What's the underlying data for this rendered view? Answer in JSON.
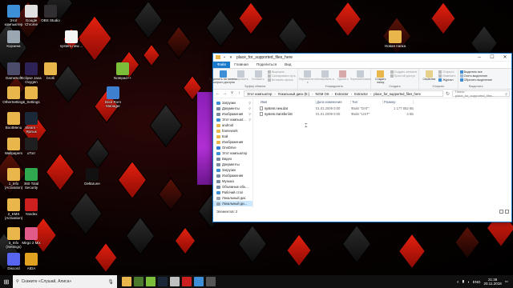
{
  "desktop_icons": [
    {
      "label": "Этот\nкомпьютер",
      "icon": "computer-icon",
      "color": "#3d8fd6"
    },
    {
      "label": "Google\nChrome",
      "icon": "chrome-icon",
      "color": "#e0e0e0"
    },
    {
      "label": "OBS Studio",
      "icon": "obs-icon",
      "color": "#302e31"
    },
    {
      "label": "Корзина",
      "icon": "recycle-bin-icon",
      "color": "#9aa6b2"
    },
    {
      "label": "system.new....",
      "icon": "file-icon",
      "color": "#f5f5f5"
    },
    {
      "label": "Новая папка",
      "icon": "folder-icon",
      "color": "#e8b64a"
    },
    {
      "label": "GameSoft",
      "icon": "gamesoft-icon",
      "color": "#4b4b6a"
    },
    {
      "label": "Eclipse Java\nOxygen",
      "icon": "eclipse-icon",
      "color": "#2c2255"
    },
    {
      "label": "brotli",
      "icon": "folder-icon",
      "color": "#e8b64a"
    },
    {
      "label": "Notepad++",
      "icon": "notepadpp-icon",
      "color": "#7cbd3a"
    },
    {
      "label": "OtherSettings",
      "icon": "folder-icon",
      "color": "#e8b64a"
    },
    {
      "label": "4_Settings",
      "icon": "folder-icon",
      "color": "#e8b64a"
    },
    {
      "label": "Boot Rom\nManager",
      "icon": "boot-rom-icon",
      "color": "#3f7fd0"
    },
    {
      "label": "BootMenu",
      "icon": "folder-icon",
      "color": "#e8b64a"
    },
    {
      "label": "Steam -\nЯрлык",
      "icon": "steam-icon",
      "color": "#1b2838"
    },
    {
      "label": "Wallpapers",
      "icon": "folder-icon",
      "color": "#e8b64a"
    },
    {
      "label": "uTorr",
      "icon": "utorrent-icon",
      "color": "#1f1f1f"
    },
    {
      "label": "Deltarune",
      "icon": "deltarune-icon",
      "color": "#111111"
    },
    {
      "label": "1_Info\n(Activation)",
      "icon": "folder-icon",
      "color": "#e8b64a"
    },
    {
      "label": "360 Total\nSecurity",
      "icon": "security-icon",
      "color": "#2fa84f"
    },
    {
      "label": "2_KMS\n(Activation)",
      "icon": "folder-icon",
      "color": "#e8b64a"
    },
    {
      "label": "Yandex",
      "icon": "yandex-icon",
      "color": "#cc1f1f"
    },
    {
      "label": "3_Info\n(Settings)",
      "icon": "folder-icon",
      "color": "#e8b64a"
    },
    {
      "label": "Mirgo 2 Mix",
      "icon": "mirgo-icon",
      "color": "#e05a8a"
    },
    {
      "label": "Discord",
      "icon": "discord-icon",
      "color": "#5865f2"
    },
    {
      "label": "AIDA",
      "icon": "aida-icon",
      "color": "#e0a020"
    }
  ],
  "explorer": {
    "title": "place_for_supported_files_here",
    "tabs": [
      "Файл",
      "Главная",
      "Поделиться",
      "Вид"
    ],
    "ribbon": {
      "clipboard": {
        "name": "Буфер обмена",
        "pin": "Закрепить на панели быстрого доступа",
        "copy": "Копировать",
        "paste": "Вставить",
        "cut": "Вырезать",
        "copy_path": "Скопировать путь",
        "paste_shortcut": "Вставить ярлык"
      },
      "organize": {
        "name": "Упорядочить",
        "move": "Переместить в",
        "copy_to": "Копировать в",
        "delete": "Удалить",
        "rename": "Переименовать"
      },
      "new": {
        "name": "Создать",
        "new_folder": "Создать папку",
        "new_item": "Создать элемент",
        "easy_access": "Простой доступ"
      },
      "open": {
        "name": "Открыть",
        "properties": "Свойства",
        "open": "Открыть",
        "edit": "Изменить",
        "history": "Журнал"
      },
      "select": {
        "name": "Выделить",
        "select_all": "Выделить все",
        "select_none": "Снять выделение",
        "invert": "Обратить выделение"
      }
    },
    "breadcrumb": [
      "Этот компьютер",
      "Локальный диск (E:)",
      "NGM OS",
      "Extractor",
      "Extractor",
      "place_for_supported_files_here"
    ],
    "search_placeholder": "Поиск: place_for_supported_files...",
    "nav": [
      {
        "label": "Загрузки",
        "color": "#3d8fd6",
        "pin": true
      },
      {
        "label": "Документы",
        "color": "#7a8da3",
        "pin": true
      },
      {
        "label": "Изображения",
        "color": "#7a8da3",
        "pin": true
      },
      {
        "label": "Этот компьют...",
        "color": "#3d8fd6",
        "pin": true
      },
      {
        "label": "android",
        "color": "#e8b64a",
        "pin": false
      },
      {
        "label": "framework",
        "color": "#e8b64a",
        "pin": false
      },
      {
        "label": "Бэй",
        "color": "#e8b64a",
        "pin": false
      },
      {
        "label": "Изображения",
        "color": "#e8b64a",
        "pin": false
      },
      {
        "label": "OneDrive",
        "color": "#2f7fd6",
        "pin": false
      },
      {
        "label": "Этот компьютер",
        "color": "#3d8fd6",
        "pin": false
      },
      {
        "label": "Видео",
        "color": "#7a8da3",
        "pin": false
      },
      {
        "label": "Документы",
        "color": "#7a8da3",
        "pin": false
      },
      {
        "label": "Загрузки",
        "color": "#3d8fd6",
        "pin": false
      },
      {
        "label": "Изображения",
        "color": "#7a8da3",
        "pin": false
      },
      {
        "label": "Музыка",
        "color": "#7a8da3",
        "pin": false
      },
      {
        "label": "Объемные объ...",
        "color": "#7a8da3",
        "pin": false
      },
      {
        "label": "Рабочий стол",
        "color": "#3d8fd6",
        "pin": false
      },
      {
        "label": "Локальный дис",
        "color": "#9aa6b2",
        "pin": false
      },
      {
        "label": "Локальный ди...",
        "color": "#9aa6b2",
        "pin": false
      }
    ],
    "columns": [
      "Имя",
      "Дата изменения",
      "Тип",
      "Размер"
    ],
    "files": [
      {
        "name": "system.new.dat",
        "date": "01.01.2009 0:00",
        "type": "Файл \"DAT\"",
        "size": "1 177 852 КБ"
      },
      {
        "name": "system.transfer.list",
        "date": "01.01.2009 0:00",
        "type": "Файл \"LIST\"",
        "size": "3 КБ"
      }
    ],
    "status": "Элементов: 2"
  },
  "taskbar": {
    "search_placeholder": "Скажите «Слушай, Алиса»",
    "apps": [
      {
        "icon": "explorer-icon",
        "color": "#e8b64a"
      },
      {
        "icon": "minecraft-icon",
        "color": "#4b7a2e"
      },
      {
        "icon": "android-icon",
        "color": "#7cbd3a"
      },
      {
        "icon": "steam-icon",
        "color": "#1b2838"
      },
      {
        "icon": "chrome-icon",
        "color": "#c0c0c0"
      },
      {
        "icon": "yandex-icon",
        "color": "#cc1f1f"
      },
      {
        "icon": "files-icon",
        "color": "#3d8fd6"
      },
      {
        "icon": "app-icon",
        "color": "#555555"
      }
    ],
    "lang": "ENG",
    "time": "21:38",
    "date": "20.11.2018"
  }
}
